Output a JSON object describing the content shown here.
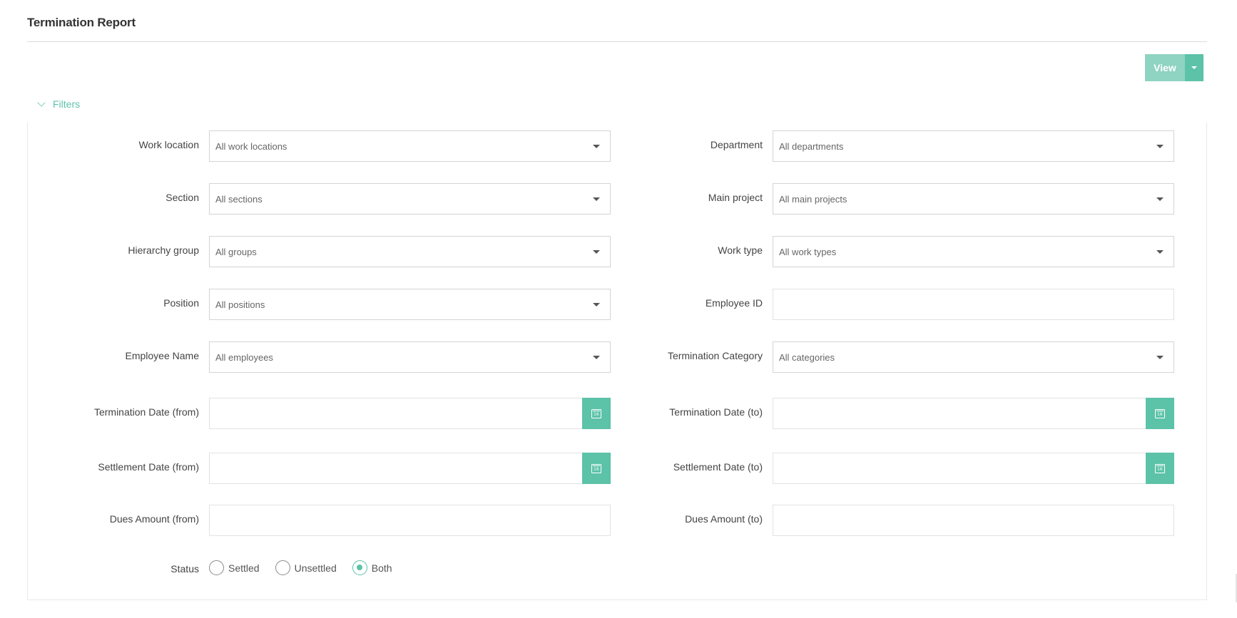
{
  "page": {
    "title": "Termination Report"
  },
  "toolbar": {
    "view_label": "View"
  },
  "filters": {
    "toggle_label": "Filters",
    "work_location": {
      "label": "Work location",
      "value": "All work locations"
    },
    "department": {
      "label": "Department",
      "value": "All departments"
    },
    "section": {
      "label": "Section",
      "value": "All sections"
    },
    "main_project": {
      "label": "Main project",
      "value": "All main projects"
    },
    "hierarchy_group": {
      "label": "Hierarchy group",
      "value": "All groups"
    },
    "work_type": {
      "label": "Work type",
      "value": "All work types"
    },
    "position": {
      "label": "Position",
      "value": "All positions"
    },
    "employee_id": {
      "label": "Employee ID",
      "value": ""
    },
    "employee_name": {
      "label": "Employee Name",
      "value": "All employees"
    },
    "termination_category": {
      "label": "Termination Category",
      "value": "All categories"
    },
    "termination_date_from": {
      "label": "Termination Date (from)",
      "value": ""
    },
    "termination_date_to": {
      "label": "Termination Date (to)",
      "value": ""
    },
    "settlement_date_from": {
      "label": "Settlement Date (from)",
      "value": ""
    },
    "settlement_date_to": {
      "label": "Settlement Date (to)",
      "value": ""
    },
    "dues_amount_from": {
      "label": "Dues Amount (from)",
      "value": ""
    },
    "dues_amount_to": {
      "label": "Dues Amount (to)",
      "value": ""
    },
    "status": {
      "label": "Status",
      "options": [
        "Settled",
        "Unsettled",
        "Both"
      ],
      "selected": "Both"
    }
  },
  "icons": {
    "calendar": "calendar-icon",
    "calendar_day": "16",
    "dropdown": "caret-down-icon",
    "collapse": "chevron-down-icon"
  },
  "colors": {
    "accent": "#5cc2a8",
    "accent_light": "#8fd3c2"
  }
}
